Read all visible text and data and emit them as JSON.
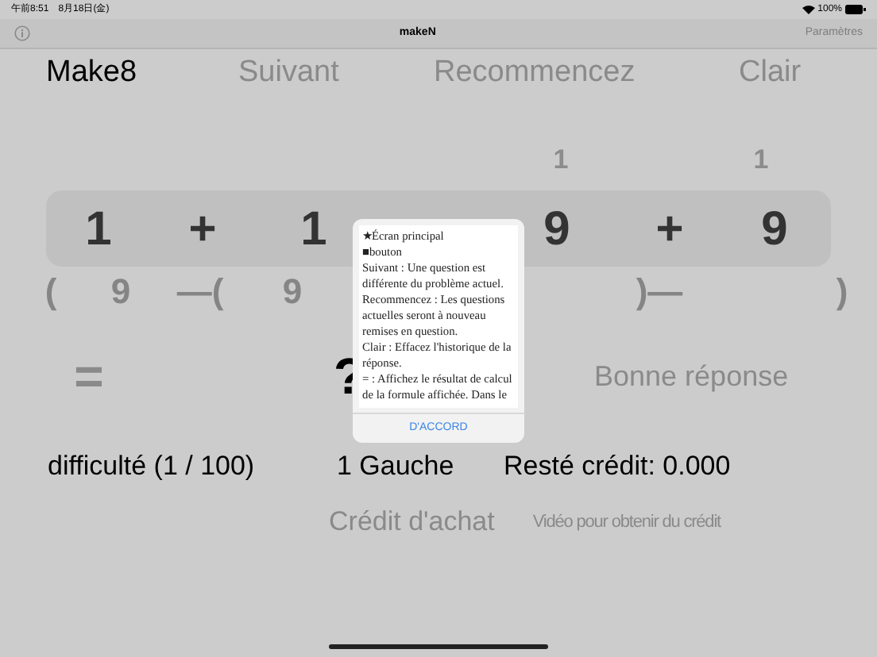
{
  "status_bar": {
    "time": "午前8:51",
    "date": "8月18日(金)",
    "battery": "100%"
  },
  "nav_bar": {
    "title": "makeN",
    "right_button": "Paramètres"
  },
  "header": {
    "title": "Make8",
    "buttons": [
      "Suivant",
      "Recommencez",
      "Clair"
    ]
  },
  "marks_row": [
    "1",
    "1"
  ],
  "expression_row": [
    "1",
    "+",
    "1",
    "9",
    "+",
    "9"
  ],
  "hint_row": [
    "(",
    "9",
    "—(",
    "9",
    ")—",
    ")"
  ],
  "answer_row": {
    "equals": "=",
    "result": "?",
    "status": "Bonne réponse"
  },
  "info_row": [
    "difficulté (1 / 100)",
    "1 Gauche",
    "Resté crédit: 0.000"
  ],
  "credit_row": {
    "buy": "Crédit d'achat",
    "video": "Vidéo pour obtenir du crédit"
  },
  "alert": {
    "lines": [
      "★Écran principal",
      "■bouton",
      "Suivant : Une question est différente du problème actuel.",
      "Recommencez : Les questions actuelles seront à nouveau remises en question.",
      "Clair : Effacez l'historique de la réponse.",
      "= : Affichez le résultat de calcul de la formule affichée. Dans le"
    ],
    "button": "D'ACCORD"
  }
}
